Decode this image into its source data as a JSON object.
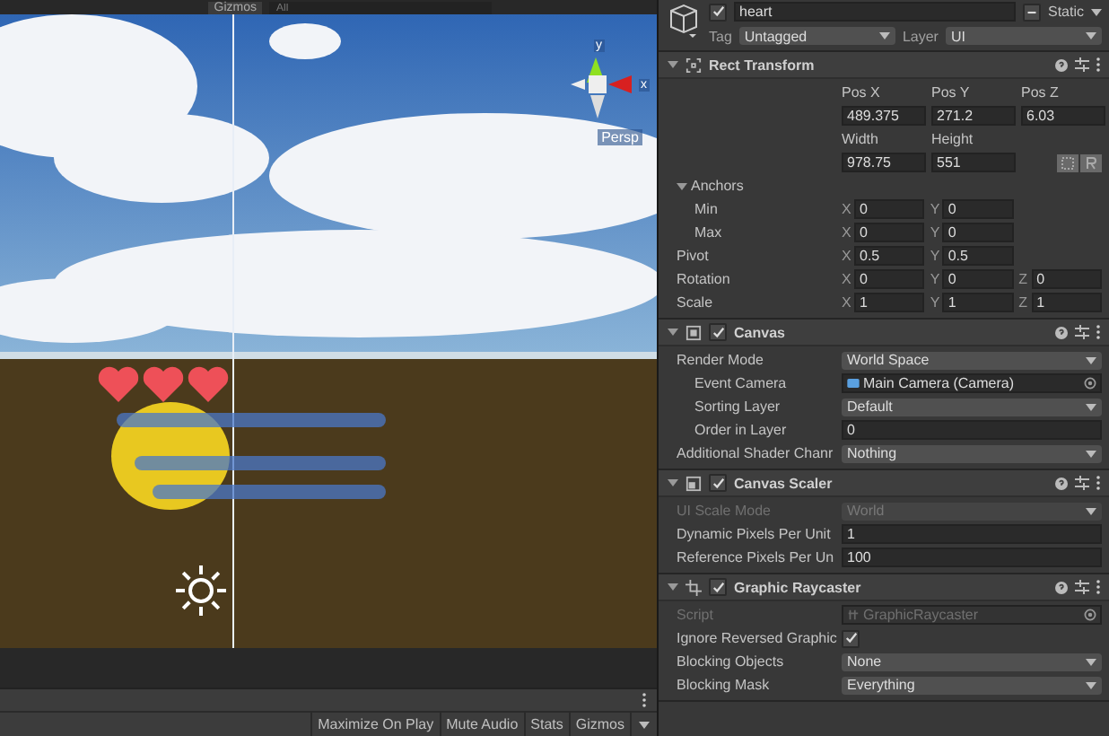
{
  "scene_toolbar": {
    "gizmos": "Gizmos",
    "search_placeholder": "All"
  },
  "scene": {
    "axis_labels": [
      "y",
      "x"
    ],
    "projection": "Persp"
  },
  "game_toolbar": {
    "buttons": [
      "Maximize On Play",
      "Mute Audio",
      "Stats",
      "Gizmos"
    ]
  },
  "inspector": {
    "name": "heart",
    "active": true,
    "static_label": "Static",
    "static_mixed": true,
    "tag_label": "Tag",
    "tag": "Untagged",
    "layer_label": "Layer",
    "layer": "UI",
    "components": [
      {
        "kind": "rect_transform",
        "title": "Rect Transform",
        "rows": [
          {
            "kind": "headers",
            "cells": [
              "Pos X",
              "Pos Y",
              "Pos Z"
            ]
          },
          {
            "kind": "values",
            "cells": [
              "489.375",
              "271.2",
              "6.03"
            ]
          },
          {
            "kind": "headers",
            "cells": [
              "Width",
              "Height"
            ]
          },
          {
            "kind": "values",
            "cells": [
              "978.75",
              "551"
            ],
            "buttons": true
          },
          {
            "kind": "foldout",
            "label": "Anchors",
            "expanded": true,
            "children": [
              {
                "kind": "vector",
                "label": "Min",
                "disabled": false,
                "axes": [
                  {
                    "axis": "X",
                    "value": "0"
                  },
                  {
                    "axis": "Y",
                    "value": "0"
                  }
                ]
              },
              {
                "kind": "vector",
                "label": "Max",
                "disabled": false,
                "axes": [
                  {
                    "axis": "X",
                    "value": "0"
                  },
                  {
                    "axis": "Y",
                    "value": "0"
                  }
                ]
              }
            ]
          },
          {
            "kind": "vector",
            "label": "Pivot",
            "disabled": false,
            "axes": [
              {
                "axis": "X",
                "value": "0.5"
              },
              {
                "axis": "Y",
                "value": "0.5"
              }
            ]
          },
          {
            "kind": "vector",
            "label": "Rotation",
            "disabled": false,
            "axes": [
              {
                "axis": "X",
                "value": "0"
              },
              {
                "axis": "Y",
                "value": "0"
              },
              {
                "axis": "Z",
                "value": "0"
              }
            ]
          },
          {
            "kind": "vector",
            "label": "Scale",
            "disabled": false,
            "axes": [
              {
                "axis": "X",
                "value": "1"
              },
              {
                "axis": "Y",
                "value": "1"
              },
              {
                "axis": "Z",
                "value": "1"
              }
            ]
          }
        ]
      },
      {
        "kind": "canvas",
        "title": "Canvas",
        "enabled": true,
        "rows": [
          {
            "kind": "dropdown",
            "label": "Render Mode",
            "value": "World Space",
            "disabled": false,
            "children": [
              {
                "kind": "object",
                "label": "Event Camera",
                "value": "Main Camera (Camera)",
                "disabled": false
              },
              {
                "kind": "dropdown",
                "label": "Sorting Layer",
                "value": "Default",
                "disabled": false
              },
              {
                "kind": "number",
                "label": "Order in Layer",
                "value": "0",
                "disabled": false
              }
            ]
          },
          {
            "kind": "dropdown",
            "label": "Additional Shader Chanr",
            "value": "Nothing",
            "disabled": false
          }
        ]
      },
      {
        "kind": "canvas_scaler",
        "title": "Canvas Scaler",
        "enabled": true,
        "rows": [
          {
            "kind": "dropdown",
            "label": "UI Scale Mode",
            "value": "World",
            "disabled": true
          },
          {
            "kind": "number",
            "label": "Dynamic Pixels Per Unit",
            "value": "1",
            "disabled": false
          },
          {
            "kind": "number",
            "label": "Reference Pixels Per Un",
            "value": "100",
            "disabled": false
          }
        ]
      },
      {
        "kind": "graphic_raycaster",
        "title": "Graphic Raycaster",
        "enabled": true,
        "rows": [
          {
            "kind": "object",
            "label": "Script",
            "value": "GraphicRaycaster",
            "disabled": true
          },
          {
            "kind": "checkbox",
            "label": "Ignore Reversed Graphic",
            "checked": true,
            "disabled": false
          },
          {
            "kind": "dropdown",
            "label": "Blocking Objects",
            "value": "None",
            "disabled": false
          },
          {
            "kind": "dropdown",
            "label": "Blocking Mask",
            "value": "Everything",
            "disabled": false
          }
        ]
      }
    ]
  }
}
